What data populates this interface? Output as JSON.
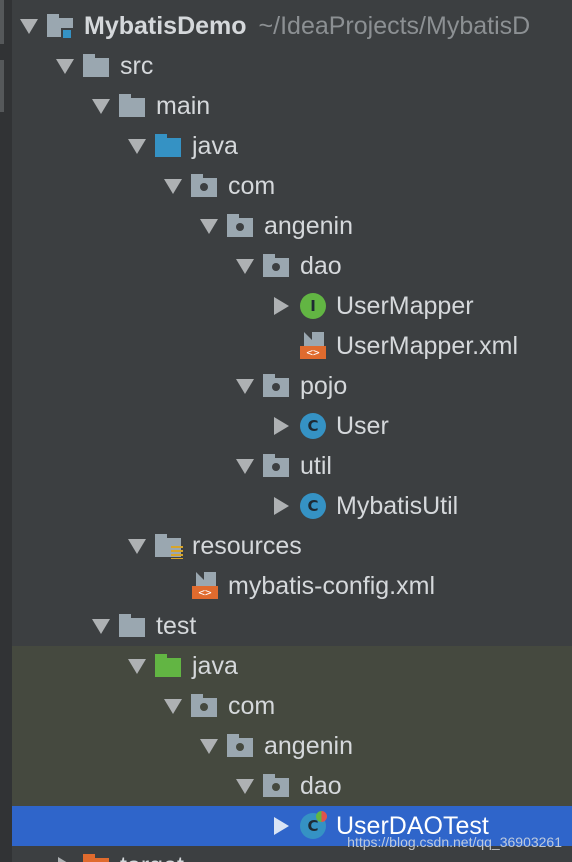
{
  "tree": {
    "project": {
      "name": "MybatisDemo",
      "path": "~/IdeaProjects/MybatisD"
    },
    "nodes": [
      {
        "label": "src"
      },
      {
        "label": "main"
      },
      {
        "label": "java"
      },
      {
        "label": "com"
      },
      {
        "label": "angenin"
      },
      {
        "label": "dao"
      },
      {
        "label": "UserMapper",
        "icon_letter": "I"
      },
      {
        "label": "UserMapper.xml",
        "icon_text": "<>"
      },
      {
        "label": "pojo"
      },
      {
        "label": "User",
        "icon_letter": "C"
      },
      {
        "label": "util"
      },
      {
        "label": "MybatisUtil",
        "icon_letter": "C"
      },
      {
        "label": "resources"
      },
      {
        "label": "mybatis-config.xml",
        "icon_text": "<>"
      },
      {
        "label": "test"
      },
      {
        "label": "java"
      },
      {
        "label": "com"
      },
      {
        "label": "angenin"
      },
      {
        "label": "dao"
      },
      {
        "label": "UserDAOTest",
        "icon_letter": "C"
      },
      {
        "label": "target"
      }
    ]
  },
  "watermark": "https://blog.csdn.net/qq_36903261",
  "colors": {
    "background": "#3c3f41",
    "selection": "#2f65ca",
    "test_scope": "#45493f",
    "folder": "#9aa7b0",
    "source_root": "#3592c4",
    "test_root": "#62b543",
    "target_folder": "#e06b2e",
    "class_icon": "#3592c4",
    "interface_icon": "#62b543",
    "xml_tag": "#e06b2e"
  }
}
